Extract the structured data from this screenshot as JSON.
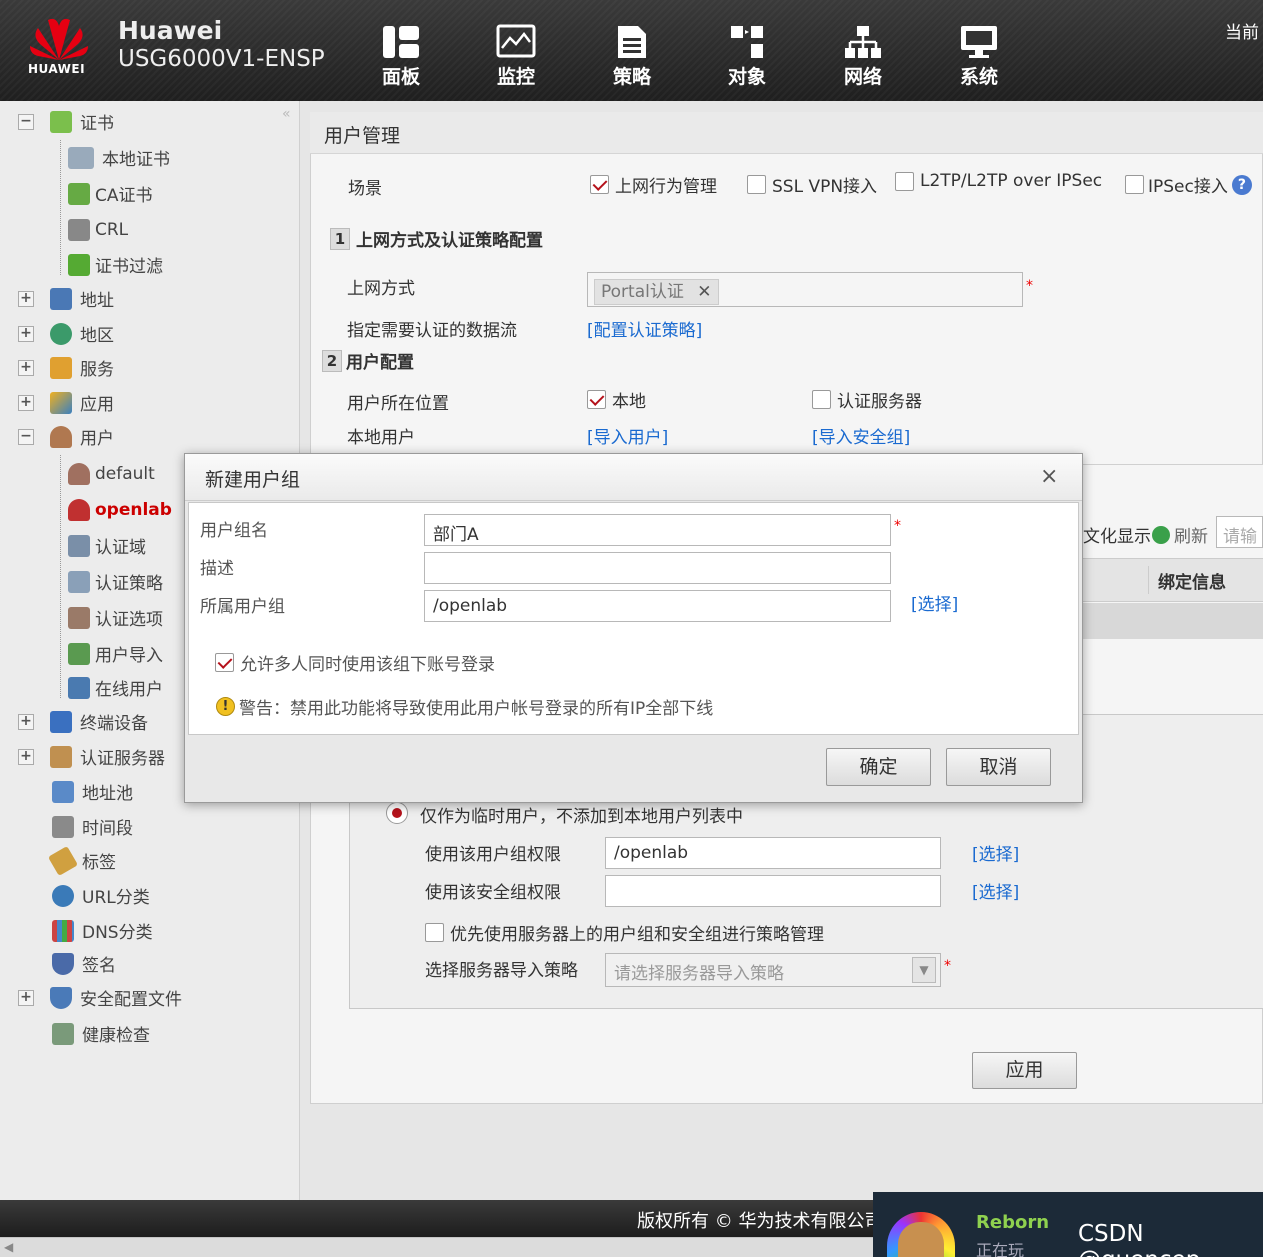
{
  "header": {
    "brand_logo_text": "HUAWEI",
    "brand_name": "Huawei",
    "device_model": "USG6000V1-ENSP",
    "current_label": "当前",
    "nav": [
      {
        "label": "面板",
        "icon": "dashboard-icon"
      },
      {
        "label": "监控",
        "icon": "monitor-icon"
      },
      {
        "label": "策略",
        "icon": "policy-icon"
      },
      {
        "label": "对象",
        "icon": "object-icon"
      },
      {
        "label": "网络",
        "icon": "network-icon"
      },
      {
        "label": "系统",
        "icon": "system-icon"
      }
    ]
  },
  "sidebar": {
    "collapse_glyph": "«",
    "items": [
      {
        "label": "证书",
        "toggle": "−",
        "icon": "certificate-icon"
      },
      {
        "label": "本地证书",
        "icon": "local-certificate-icon"
      },
      {
        "label": "CA证书",
        "icon": "ca-certificate-icon"
      },
      {
        "label": "CRL",
        "icon": "crl-icon"
      },
      {
        "label": "证书过滤",
        "icon": "certificate-filter-icon"
      },
      {
        "label": "地址",
        "toggle": "+",
        "icon": "address-icon"
      },
      {
        "label": "地区",
        "toggle": "+",
        "icon": "region-icon"
      },
      {
        "label": "服务",
        "toggle": "+",
        "icon": "service-icon"
      },
      {
        "label": "应用",
        "toggle": "+",
        "icon": "application-icon"
      },
      {
        "label": "用户",
        "toggle": "−",
        "icon": "user-icon"
      },
      {
        "label": "default",
        "icon": "user-group-icon"
      },
      {
        "label": "openlab",
        "icon": "user-group-icon"
      },
      {
        "label": "认证域",
        "icon": "auth-domain-icon"
      },
      {
        "label": "认证策略",
        "icon": "auth-policy-icon"
      },
      {
        "label": "认证选项",
        "icon": "auth-option-icon"
      },
      {
        "label": "用户导入",
        "icon": "user-import-icon"
      },
      {
        "label": "在线用户",
        "icon": "online-user-icon"
      },
      {
        "label": "终端设备",
        "toggle": "+",
        "icon": "terminal-device-icon"
      },
      {
        "label": "认证服务器",
        "toggle": "+",
        "icon": "auth-server-icon"
      },
      {
        "label": "地址池",
        "icon": "address-pool-icon"
      },
      {
        "label": "时间段",
        "icon": "time-range-icon"
      },
      {
        "label": "标签",
        "icon": "tag-icon"
      },
      {
        "label": "URL分类",
        "icon": "url-category-icon"
      },
      {
        "label": "DNS分类",
        "icon": "dns-category-icon"
      },
      {
        "label": "签名",
        "icon": "signature-icon"
      },
      {
        "label": "安全配置文件",
        "toggle": "+",
        "icon": "security-profile-icon"
      },
      {
        "label": "健康检查",
        "icon": "health-check-icon"
      }
    ]
  },
  "main": {
    "title": "用户管理",
    "scenario_label": "场景",
    "scenarios": [
      {
        "label": "上网行为管理",
        "checked": true
      },
      {
        "label": "SSL VPN接入",
        "checked": false
      },
      {
        "label": "L2TP/L2TP over IPSec",
        "checked": false
      },
      {
        "label": "IPSec接入",
        "checked": false
      }
    ],
    "step1": {
      "num": "1",
      "title": "上网方式及认证策略配置"
    },
    "access_mode_label": "上网方式",
    "access_mode_tag": "Portal认证",
    "tag_remove": "✕",
    "auth_flow_label": "指定需要认证的数据流",
    "auth_flow_link": "[配置认证策略]",
    "step2": {
      "num": "2",
      "title": "用户配置"
    },
    "user_location_label": "用户所在位置",
    "location_local": {
      "label": "本地",
      "checked": true
    },
    "location_server": {
      "label": "认证服务器",
      "checked": false
    },
    "local_user_label": "本地用户",
    "import_user_link": "[导入用户]",
    "import_group_link": "[导入安全组]",
    "toolbar_partial": "文化显示",
    "refresh_label": "刷新",
    "search_placeholder": "请输",
    "col_bind_info": "绑定信息",
    "temp_user_label": "仅作为临时用户，不添加到本地用户列表中",
    "use_group_perm_label": "使用该用户组权限",
    "use_group_perm_value": "/openlab",
    "use_security_perm_label": "使用该安全组权限",
    "use_security_perm_value": "",
    "select_link": "[选择]",
    "prefer_server_label": "优先使用服务器上的用户组和安全组进行策略管理",
    "import_policy_label": "选择服务器导入策略",
    "import_policy_placeholder": "请选择服务器导入策略",
    "apply_button": "应用",
    "required_mark": "*"
  },
  "dialog": {
    "title": "新建用户组",
    "close_glyph": "×",
    "name_label": "用户组名",
    "name_value": "部门A",
    "desc_label": "描述",
    "desc_value": "",
    "parent_label": "所属用户组",
    "parent_value": "/openlab",
    "select_link": "[选择]",
    "allow_multi_label": "允许多人同时使用该组下账号登录",
    "allow_multi_checked": true,
    "warning_text": "警告：禁用此功能将导致使用此用户帐号登录的所有IP全部下线",
    "ok_button": "确定",
    "cancel_button": "取消",
    "required_mark": "*"
  },
  "footer": {
    "copyright": "版权所有 © 华为技术有限公司"
  },
  "overlay": {
    "game": "Reborn",
    "status": "正在玩",
    "watermark": "CSDN @quencep"
  },
  "colors": {
    "header_bg": "#2a2a2a",
    "link": "#1a6ad0",
    "selected": "#cc0000",
    "check": "#b5121b",
    "huawei_red": "#e60012"
  }
}
